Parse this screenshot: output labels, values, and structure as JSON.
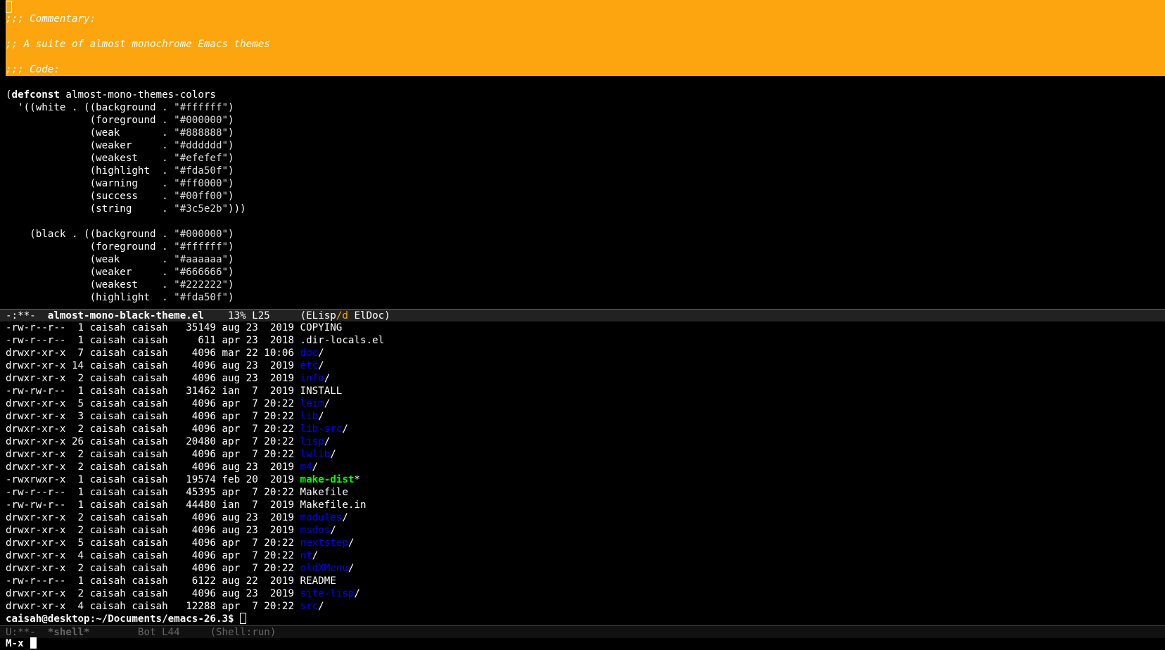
{
  "colors": {
    "background": "#000000",
    "foreground": "#ffffff",
    "highlight": "#fda50f",
    "directory": "#0000ff",
    "executable": "#00ff00",
    "modeline_inactive_text": "#666666"
  },
  "editor": {
    "comments": [
      ";;; Commentary:",
      ";; A suite of almost monochrome Emacs themes",
      ";;; Code:"
    ],
    "defconst_keyword": "defconst",
    "defconst_name": " almost-mono-themes-colors",
    "code_lines": [
      {
        "pre": "  '((white . ((",
        "key": "background",
        "sep": " . ",
        "val": "\"#ffffff\"",
        "post": ")"
      },
      {
        "pre": "              (",
        "key": "foreground",
        "sep": " . ",
        "val": "\"#000000\"",
        "post": ")"
      },
      {
        "pre": "              (",
        "key": "weak      ",
        "sep": " . ",
        "val": "\"#888888\"",
        "post": ")"
      },
      {
        "pre": "              (",
        "key": "weaker    ",
        "sep": " . ",
        "val": "\"#dddddd\"",
        "post": ")"
      },
      {
        "pre": "              (",
        "key": "weakest   ",
        "sep": " . ",
        "val": "\"#efefef\"",
        "post": ")"
      },
      {
        "pre": "              (",
        "key": "highlight ",
        "sep": " . ",
        "val": "\"#fda50f\"",
        "post": ")"
      },
      {
        "pre": "              (",
        "key": "warning   ",
        "sep": " . ",
        "val": "\"#ff0000\"",
        "post": ")"
      },
      {
        "pre": "              (",
        "key": "success   ",
        "sep": " . ",
        "val": "\"#00ff00\"",
        "post": ")"
      },
      {
        "pre": "              (",
        "key": "string    ",
        "sep": " . ",
        "val": "\"#3c5e2b\"",
        "post": ")))"
      },
      {
        "pre": "",
        "key": "",
        "sep": "",
        "val": "",
        "post": ""
      },
      {
        "pre": "    (black . ((",
        "key": "background",
        "sep": " . ",
        "val": "\"#000000\"",
        "post": ")"
      },
      {
        "pre": "              (",
        "key": "foreground",
        "sep": " . ",
        "val": "\"#ffffff\"",
        "post": ")"
      },
      {
        "pre": "              (",
        "key": "weak      ",
        "sep": " . ",
        "val": "\"#aaaaaa\"",
        "post": ")"
      },
      {
        "pre": "              (",
        "key": "weaker    ",
        "sep": " . ",
        "val": "\"#666666\"",
        "post": ")"
      },
      {
        "pre": "              (",
        "key": "weakest   ",
        "sep": " . ",
        "val": "\"#222222\"",
        "post": ")"
      },
      {
        "pre": "              (",
        "key": "highlight ",
        "sep": " . ",
        "val": "\"#fda50f\"",
        "post": ")"
      }
    ]
  },
  "modeline_top": {
    "status": "-:**-  ",
    "buffer_name": "almost-mono-black-theme.el",
    "position": "    13% L25     ",
    "mode_open": "(ELisp",
    "mode_flag": "/d",
    "mode_rest": " ElDoc)"
  },
  "shell": {
    "rows": [
      {
        "meta": "-rw-r--r--  1 caisah caisah   35149 aug 23  2019 ",
        "name": "COPYING",
        "kind": "file",
        "suffix": ""
      },
      {
        "meta": "-rw-r--r--  1 caisah caisah     611 apr 23  2018 ",
        "name": ".dir-locals.el",
        "kind": "file",
        "suffix": ""
      },
      {
        "meta": "drwxr-xr-x  7 caisah caisah    4096 mar 22 10:06 ",
        "name": "doc",
        "kind": "dir",
        "suffix": "/"
      },
      {
        "meta": "drwxr-xr-x 14 caisah caisah    4096 aug 23  2019 ",
        "name": "etc",
        "kind": "dir",
        "suffix": "/"
      },
      {
        "meta": "drwxr-xr-x  2 caisah caisah    4096 aug 23  2019 ",
        "name": "info",
        "kind": "dir",
        "suffix": "/"
      },
      {
        "meta": "-rw-rw-r--  1 caisah caisah   31462 ian  7  2019 ",
        "name": "INSTALL",
        "kind": "file",
        "suffix": ""
      },
      {
        "meta": "drwxr-xr-x  5 caisah caisah    4096 apr  7 20:22 ",
        "name": "leim",
        "kind": "dir",
        "suffix": "/"
      },
      {
        "meta": "drwxr-xr-x  3 caisah caisah    4096 apr  7 20:22 ",
        "name": "lib",
        "kind": "dir",
        "suffix": "/"
      },
      {
        "meta": "drwxr-xr-x  2 caisah caisah    4096 apr  7 20:22 ",
        "name": "lib-src",
        "kind": "dir",
        "suffix": "/"
      },
      {
        "meta": "drwxr-xr-x 26 caisah caisah   20480 apr  7 20:22 ",
        "name": "lisp",
        "kind": "dir",
        "suffix": "/"
      },
      {
        "meta": "drwxr-xr-x  2 caisah caisah    4096 apr  7 20:22 ",
        "name": "lwlib",
        "kind": "dir",
        "suffix": "/"
      },
      {
        "meta": "drwxr-xr-x  2 caisah caisah    4096 aug 23  2019 ",
        "name": "m4",
        "kind": "dir",
        "suffix": "/"
      },
      {
        "meta": "-rwxrwxr-x  1 caisah caisah   19574 feb 20  2019 ",
        "name": "make-dist",
        "kind": "exec",
        "suffix": "*"
      },
      {
        "meta": "-rw-r--r--  1 caisah caisah   45395 apr  7 20:22 ",
        "name": "Makefile",
        "kind": "file",
        "suffix": ""
      },
      {
        "meta": "-rw-rw-r--  1 caisah caisah   44480 ian  7  2019 ",
        "name": "Makefile.in",
        "kind": "file",
        "suffix": ""
      },
      {
        "meta": "drwxr-xr-x  2 caisah caisah    4096 aug 23  2019 ",
        "name": "modules",
        "kind": "dir",
        "suffix": "/"
      },
      {
        "meta": "drwxr-xr-x  2 caisah caisah    4096 aug 23  2019 ",
        "name": "msdos",
        "kind": "dir",
        "suffix": "/"
      },
      {
        "meta": "drwxr-xr-x  5 caisah caisah    4096 apr  7 20:22 ",
        "name": "nextstep",
        "kind": "dir",
        "suffix": "/"
      },
      {
        "meta": "drwxr-xr-x  4 caisah caisah    4096 apr  7 20:22 ",
        "name": "nt",
        "kind": "dir",
        "suffix": "/"
      },
      {
        "meta": "drwxr-xr-x  2 caisah caisah    4096 apr  7 20:22 ",
        "name": "oldXMenu",
        "kind": "dir",
        "suffix": "/"
      },
      {
        "meta": "-rw-r--r--  1 caisah caisah    6122 aug 22  2019 ",
        "name": "README",
        "kind": "file",
        "suffix": ""
      },
      {
        "meta": "drwxr-xr-x  2 caisah caisah    4096 aug 23  2019 ",
        "name": "site-lisp",
        "kind": "dir",
        "suffix": "/"
      },
      {
        "meta": "drwxr-xr-x  4 caisah caisah   12288 apr  7 20:22 ",
        "name": "src",
        "kind": "dir",
        "suffix": "/"
      }
    ],
    "prompt": "caisah@desktop:~/Documents/emacs-26.3$ "
  },
  "modeline_bottom": {
    "status": "U:**-  ",
    "buffer_name": "*shell*",
    "position": "        Bot L44     ",
    "mode": "(Shell:run)"
  },
  "minibuffer": {
    "text": "M-x"
  }
}
